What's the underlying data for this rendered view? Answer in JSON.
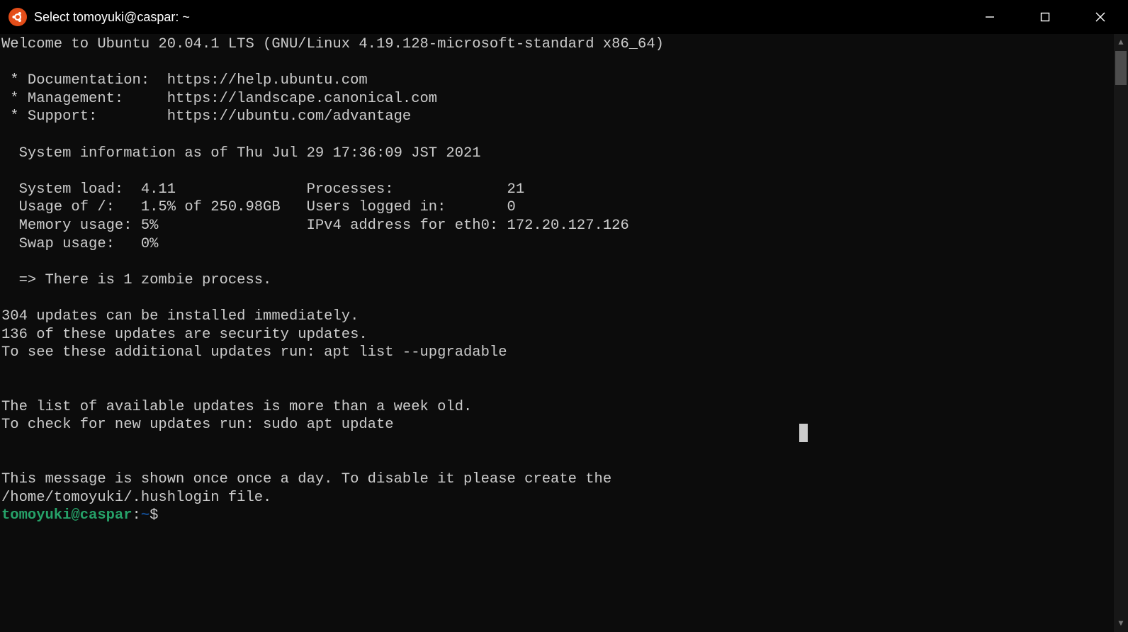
{
  "window": {
    "title": "Select tomoyuki@caspar: ~"
  },
  "motd": {
    "welcome": "Welcome to Ubuntu 20.04.1 LTS (GNU/Linux 4.19.128-microsoft-standard x86_64)",
    "links": {
      "doc_label": " * Documentation:  https://help.ubuntu.com",
      "mgmt_label": " * Management:     https://landscape.canonical.com",
      "support_label": " * Support:        https://ubuntu.com/advantage"
    },
    "sysinfo_header": "  System information as of Thu Jul 29 17:36:09 JST 2021",
    "sys": {
      "line1": "  System load:  4.11               Processes:             21",
      "line2": "  Usage of /:   1.5% of 250.98GB   Users logged in:       0",
      "line3": "  Memory usage: 5%                 IPv4 address for eth0: 172.20.127.126",
      "line4": "  Swap usage:   0%"
    },
    "zombie": "  => There is 1 zombie process.",
    "updates": {
      "u1": "304 updates can be installed immediately.",
      "u2": "136 of these updates are security updates.",
      "u3": "To see these additional updates run: apt list --upgradable"
    },
    "stale": {
      "s1": "The list of available updates is more than a week old.",
      "s2": "To check for new updates run: sudo apt update"
    },
    "hush": {
      "h1": "This message is shown once once a day. To disable it please create the",
      "h2": "/home/tomoyuki/.hushlogin file."
    }
  },
  "prompt": {
    "userhost": "tomoyuki@caspar",
    "colon": ":",
    "path": "~",
    "dollar": "$"
  }
}
